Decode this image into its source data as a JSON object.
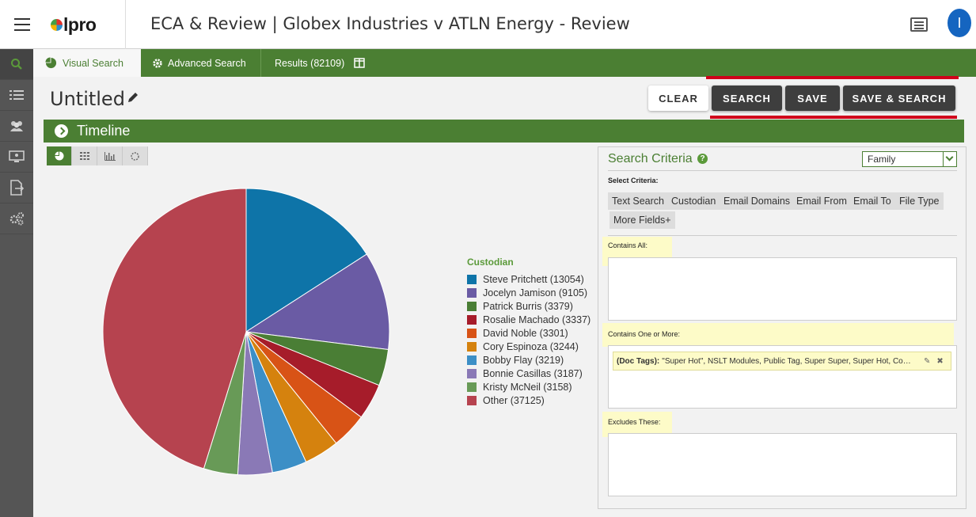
{
  "app": {
    "logo_text": "lpro",
    "title": "ECA & Review | Globex Industries v ATLN Energy - Review",
    "avatar_initial": "I"
  },
  "tabs": [
    {
      "label": "Visual Search",
      "icon": "pie-chart-icon"
    },
    {
      "label": "Advanced Search",
      "icon": "gear-icon"
    },
    {
      "label": "Results (82109)",
      "icon": "columns-icon"
    }
  ],
  "search": {
    "name": "Untitled",
    "buttons": {
      "clear": "CLEAR",
      "search": "SEARCH",
      "save": "SAVE",
      "save_search": "SAVE & SEARCH"
    }
  },
  "timeline": {
    "label": "Timeline"
  },
  "chart_data": {
    "type": "pie",
    "title": "Custodian",
    "slices": [
      {
        "label": "Steve Pritchett (13054)",
        "value": 13054,
        "color": "#0e74a8"
      },
      {
        "label": "Jocelyn Jamison (9105)",
        "value": 9105,
        "color": "#6a5ba4"
      },
      {
        "label": "Patrick Burris (3379)",
        "value": 3379,
        "color": "#4a7e35"
      },
      {
        "label": "Rosalie Machado (3337)",
        "value": 3337,
        "color": "#a61c2a"
      },
      {
        "label": "David Noble (3301)",
        "value": 3301,
        "color": "#d85316"
      },
      {
        "label": "Cory Espinoza (3244)",
        "value": 3244,
        "color": "#d5820e"
      },
      {
        "label": "Bobby Flay (3219)",
        "value": 3219,
        "color": "#3c8fc6"
      },
      {
        "label": "Bonnie Casillas (3187)",
        "value": 3187,
        "color": "#8a79b6"
      },
      {
        "label": "Kristy McNeil (3158)",
        "value": 3158,
        "color": "#689a57"
      },
      {
        "label": "Other (37125)",
        "value": 37125,
        "color": "#b6434f"
      }
    ]
  },
  "criteria": {
    "title": "Search Criteria",
    "scope": "Family",
    "select_label": "Select Criteria:",
    "chips": [
      "Text Search",
      "Custodian",
      "Email Domains",
      "Email From",
      "Email To",
      "File Type",
      "More Fields+"
    ],
    "contains_all_label": "Contains All:",
    "contains_one_label": "Contains One or More:",
    "tag_field": "(Doc Tags):",
    "tag_values": "\"Super Hot\", NSLT Modules, Public Tag, Super Super, Super Hot, Complia...",
    "excludes_label": "Excludes These:"
  }
}
